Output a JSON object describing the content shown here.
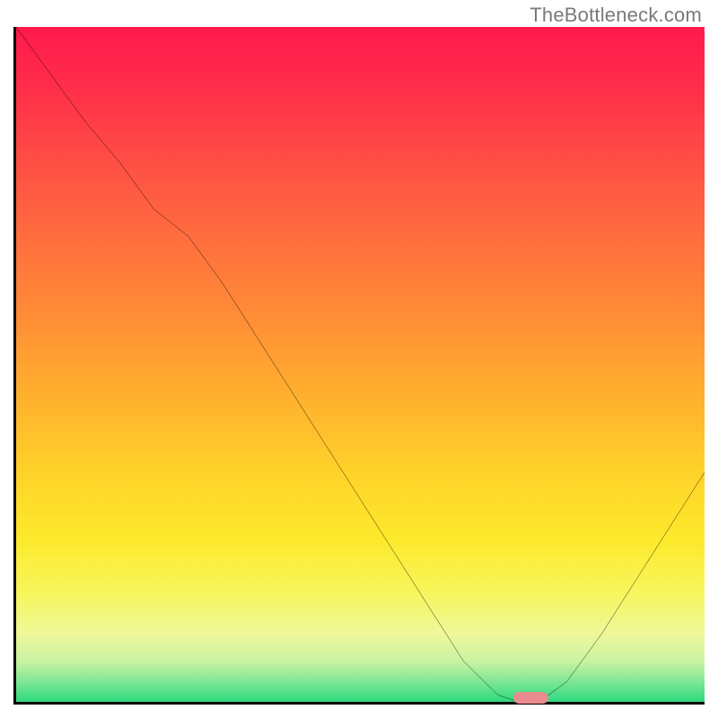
{
  "watermark": "TheBottleneck.com",
  "chart_data": {
    "type": "line",
    "title": "",
    "xlabel": "",
    "ylabel": "",
    "xlim": [
      0,
      100
    ],
    "ylim": [
      0,
      100
    ],
    "grid": false,
    "legend": false,
    "categories": [
      0,
      5,
      10,
      15,
      20,
      25,
      30,
      35,
      40,
      45,
      50,
      55,
      60,
      65,
      70,
      73,
      76,
      80,
      85,
      90,
      95,
      100
    ],
    "series": [
      {
        "name": "bottleneck-curve",
        "values": [
          100,
          93,
          86,
          80,
          73,
          69,
          62,
          54,
          46,
          38,
          30,
          22,
          14,
          6,
          1,
          0,
          0,
          3,
          10,
          18,
          26,
          34
        ]
      }
    ],
    "background_gradient": {
      "top": "#ff1a4d",
      "mid_upper": "#ff8a36",
      "mid": "#ffd229",
      "mid_lower": "#f6f65e",
      "bottom": "#2fd87e"
    },
    "marker": {
      "x_start": 72,
      "x_end": 77,
      "color": "#e98b8f",
      "shape": "rounded-bar"
    },
    "axes": {
      "left": true,
      "bottom": true,
      "color": "#000000",
      "ticks": []
    }
  },
  "icons": {},
  "colors": {
    "axis": "#000000",
    "curve": "#000000",
    "watermark": "#7a7a7a"
  }
}
